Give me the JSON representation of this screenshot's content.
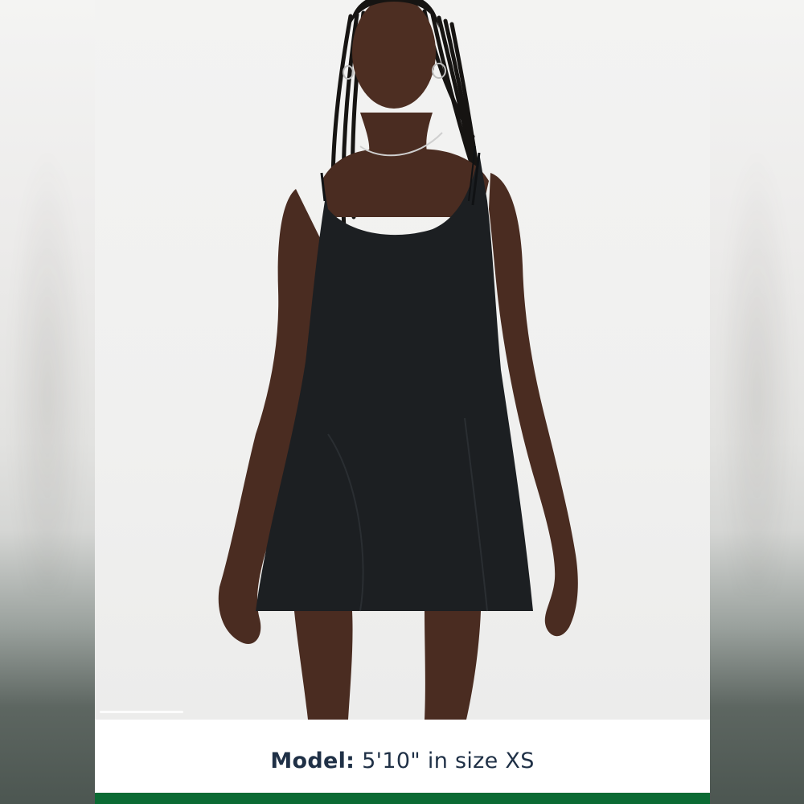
{
  "caption": {
    "label": "Model:",
    "value": "5'10\" in size XS"
  },
  "image": {
    "subject": "product-photo",
    "icon": "photo-icon"
  },
  "colors": {
    "caption_text": "#1f3046",
    "accent_bar": "#0b6b34",
    "dress": "#1c1f22",
    "background": "#f0f0ef"
  }
}
